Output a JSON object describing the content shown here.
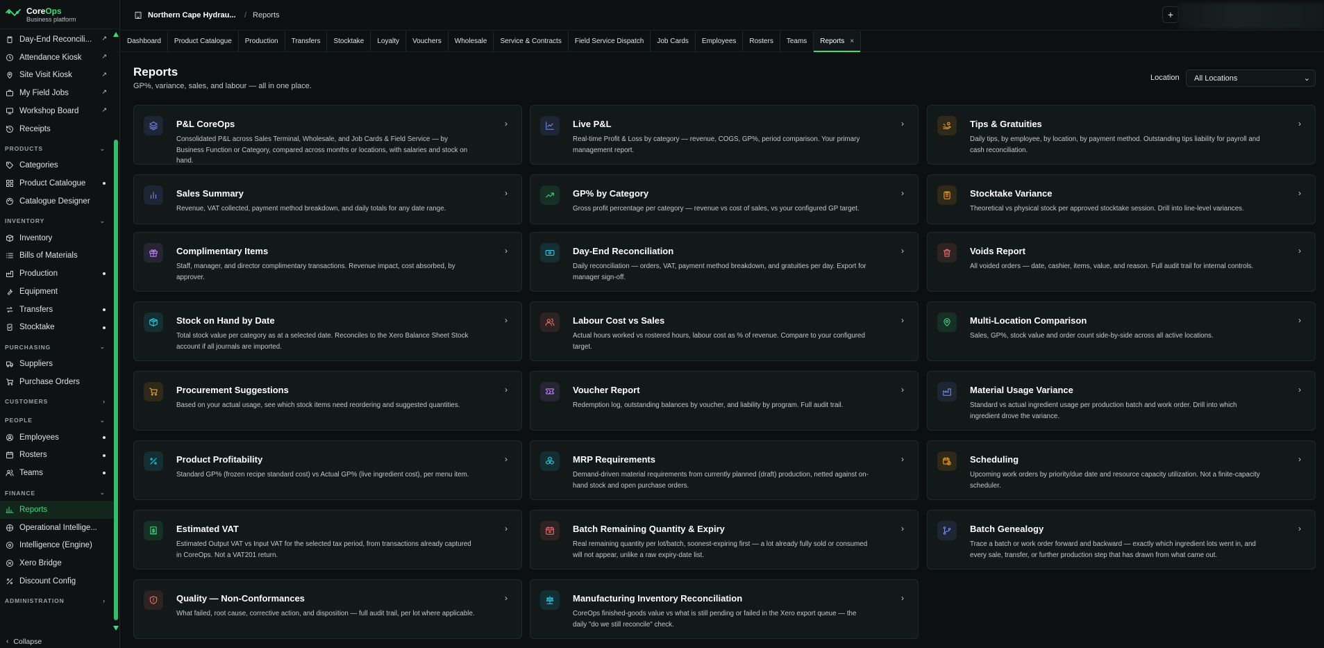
{
  "brand": {
    "name_prefix": "Core",
    "name_suffix": "Ops",
    "tagline": "Business platform"
  },
  "header": {
    "org": "Northern Cape Hydrau...",
    "separator": "/",
    "breadcrumb": "Reports",
    "plus_label": "+"
  },
  "sidebar": {
    "items": [
      {
        "type": "item",
        "label": "Day-End Reconcili...",
        "icon": "clipboard-icon",
        "ext": true
      },
      {
        "type": "item",
        "label": "Attendance Kiosk",
        "icon": "clock-icon",
        "ext": true
      },
      {
        "type": "item",
        "label": "Site Visit Kiosk",
        "icon": "pin-icon",
        "ext": true
      },
      {
        "type": "item",
        "label": "My Field Jobs",
        "icon": "briefcase-icon",
        "ext": true
      },
      {
        "type": "item",
        "label": "Workshop Board",
        "icon": "monitor-icon",
        "ext": true
      },
      {
        "type": "item",
        "label": "Receipts",
        "icon": "history-icon"
      },
      {
        "type": "section",
        "label": "PRODUCTS",
        "chev": "⌄"
      },
      {
        "type": "item",
        "label": "Categories",
        "icon": "tag-icon"
      },
      {
        "type": "item",
        "label": "Product Catalogue",
        "icon": "grid-icon",
        "dot": true
      },
      {
        "type": "item",
        "label": "Catalogue Designer",
        "icon": "palette-icon"
      },
      {
        "type": "section",
        "label": "INVENTORY",
        "chev": "⌄"
      },
      {
        "type": "item",
        "label": "Inventory",
        "icon": "box-icon"
      },
      {
        "type": "item",
        "label": "Bills of Materials",
        "icon": "list-icon"
      },
      {
        "type": "item",
        "label": "Production",
        "icon": "factory-icon",
        "dot": true
      },
      {
        "type": "item",
        "label": "Equipment",
        "icon": "wrench-icon"
      },
      {
        "type": "item",
        "label": "Transfers",
        "icon": "transfer-icon",
        "dot": true
      },
      {
        "type": "item",
        "label": "Stocktake",
        "icon": "clipboard-check-icon",
        "dot": true
      },
      {
        "type": "section",
        "label": "PURCHASING",
        "chev": "⌄"
      },
      {
        "type": "item",
        "label": "Suppliers",
        "icon": "truck-icon"
      },
      {
        "type": "item",
        "label": "Purchase Orders",
        "icon": "cart-icon"
      },
      {
        "type": "section",
        "label": "CUSTOMERS",
        "chev": "›"
      },
      {
        "type": "section",
        "label": "PEOPLE",
        "chev": "⌄"
      },
      {
        "type": "item",
        "label": "Employees",
        "icon": "user-circle-icon",
        "dot": true
      },
      {
        "type": "item",
        "label": "Rosters",
        "icon": "calendar-icon",
        "dot": true
      },
      {
        "type": "item",
        "label": "Teams",
        "icon": "users-icon",
        "dot": true
      },
      {
        "type": "section",
        "label": "FINANCE",
        "chev": "⌄"
      },
      {
        "type": "item",
        "label": "Reports",
        "icon": "chart-icon",
        "active": true
      },
      {
        "type": "item",
        "label": "Operational Intellige...",
        "icon": "brain-icon"
      },
      {
        "type": "item",
        "label": "Intelligence (Engine)",
        "icon": "cpu-icon"
      },
      {
        "type": "item",
        "label": "Xero Bridge",
        "icon": "bridge-icon"
      },
      {
        "type": "item",
        "label": "Discount Config",
        "icon": "percent-icon"
      },
      {
        "type": "section",
        "label": "ADMINISTRATION",
        "chev": "›"
      }
    ],
    "collapse_label": "Collapse"
  },
  "tabs": [
    {
      "label": "Dashboard"
    },
    {
      "label": "Product Catalogue"
    },
    {
      "label": "Production"
    },
    {
      "label": "Transfers"
    },
    {
      "label": "Stocktake"
    },
    {
      "label": "Loyalty"
    },
    {
      "label": "Vouchers"
    },
    {
      "label": "Wholesale"
    },
    {
      "label": "Service & Contracts"
    },
    {
      "label": "Field Service Dispatch"
    },
    {
      "label": "Job Cards"
    },
    {
      "label": "Employees"
    },
    {
      "label": "Rosters"
    },
    {
      "label": "Teams"
    },
    {
      "label": "Reports",
      "active": true,
      "close": "×"
    }
  ],
  "page": {
    "title": "Reports",
    "subtitle": "GP%, variance, sales, and labour — all in one place."
  },
  "location": {
    "label": "Location",
    "value": "All Locations"
  },
  "cards": [
    {
      "title": "P&L CoreOps",
      "desc": "Consolidated P&L across Sales Terminal, Wholesale, and Job Cards & Field Service — by Business Function or Category, compared across months or locations, with salaries and stock on hand.",
      "icon": "layers-icon",
      "color": "#7c8cf8"
    },
    {
      "title": "Live P&L",
      "desc": "Real-time Profit & Loss by category — revenue, COGS, GP%, period comparison. Your primary management report.",
      "icon": "line-chart-icon",
      "color": "#7c8cf8"
    },
    {
      "title": "Tips & Gratuities",
      "desc": "Daily tips, by employee, by location, by payment method. Outstanding tips liability for payroll and cash reconciliation.",
      "icon": "hand-coins-icon",
      "color": "#f5a524"
    },
    {
      "title": "Sales Summary",
      "desc": "Revenue, VAT collected, payment method breakdown, and daily totals for any date range.",
      "icon": "bar-chart-icon",
      "color": "#7c8cf8"
    },
    {
      "title": "GP% by Category",
      "desc": "Gross profit percentage per category — revenue vs cost of sales, vs your configured GP target.",
      "icon": "trending-up-icon",
      "color": "#3ddc84"
    },
    {
      "title": "Stocktake Variance",
      "desc": "Theoretical vs physical stock per approved stocktake session. Drill into line-level variances.",
      "icon": "clipboard-list-icon",
      "color": "#f5a524"
    },
    {
      "title": "Complimentary Items",
      "desc": "Staff, manager, and director complimentary transactions. Revenue impact, cost absorbed, by approver.",
      "icon": "gift-icon",
      "color": "#c084fc"
    },
    {
      "title": "Day-End Reconciliation",
      "desc": "Daily reconciliation — orders, VAT, payment method breakdown, and gratuities per day. Export for manager sign-off.",
      "icon": "banknote-icon",
      "color": "#22d3ee"
    },
    {
      "title": "Voids Report",
      "desc": "All voided orders — date, cashier, items, value, and reason. Full audit trail for internal controls.",
      "icon": "trash-icon",
      "color": "#f87171"
    },
    {
      "title": "Stock on Hand by Date",
      "desc": "Total stock value per category as at a selected date. Reconciles to the Xero Balance Sheet Stock account if all journals are imported.",
      "icon": "package-icon",
      "color": "#22d3ee"
    },
    {
      "title": "Labour Cost vs Sales",
      "desc": "Actual hours worked vs rostered hours, labour cost as % of revenue. Compare to your configured target.",
      "icon": "users-icon",
      "color": "#f87171"
    },
    {
      "title": "Multi-Location Comparison",
      "desc": "Sales, GP%, stock value and order count side-by-side across all active locations.",
      "icon": "map-pin-icon",
      "color": "#3ddc84"
    },
    {
      "title": "Procurement Suggestions",
      "desc": "Based on your actual usage, see which stock items need reordering and suggested quantities.",
      "icon": "cart-icon",
      "color": "#f5a524"
    },
    {
      "title": "Voucher Report",
      "desc": "Redemption log, outstanding balances by voucher, and liability by program. Full audit trail.",
      "icon": "ticket-icon",
      "color": "#c084fc"
    },
    {
      "title": "Material Usage Variance",
      "desc": "Standard vs actual ingredient usage per production batch and work order. Drill into which ingredient drove the variance.",
      "icon": "factory-icon",
      "color": "#7c8cf8"
    },
    {
      "title": "Product Profitability",
      "desc": "Standard GP% (frozen recipe standard cost) vs Actual GP% (live ingredient cost), per menu item.",
      "icon": "percent-icon",
      "color": "#22d3ee"
    },
    {
      "title": "MRP Requirements",
      "desc": "Demand-driven material requirements from currently planned (draft) production, netted against on-hand stock and open purchase orders.",
      "icon": "boxes-icon",
      "color": "#22d3ee"
    },
    {
      "title": "Scheduling",
      "desc": "Upcoming work orders by priority/due date and resource capacity utilization. Not a finite-capacity scheduler.",
      "icon": "calendar-clock-icon",
      "color": "#f5a524"
    },
    {
      "title": "Estimated VAT",
      "desc": "Estimated Output VAT vs Input VAT for the selected tax period, from transactions already captured in CoreOps. Not a VAT201 return.",
      "icon": "receipt-icon",
      "color": "#3ddc84"
    },
    {
      "title": "Batch Remaining Quantity & Expiry",
      "desc": "Real remaining quantity per lot/batch, soonest-expiring first — a lot already fully sold or consumed will not appear, unlike a raw expiry-date list.",
      "icon": "calendar-x-icon",
      "color": "#f87171"
    },
    {
      "title": "Batch Genealogy",
      "desc": "Trace a batch or work order forward and backward — exactly which ingredient lots went in, and every sale, transfer, or further production step that has drawn from what came out.",
      "icon": "git-branch-icon",
      "color": "#7c8cf8"
    },
    {
      "title": "Quality — Non-Conformances",
      "desc": "What failed, root cause, corrective action, and disposition — full audit trail, per lot where applicable.",
      "icon": "shield-alert-icon",
      "color": "#f87171"
    },
    {
      "title": "Manufacturing Inventory Reconciliation",
      "desc": "CoreOps finished-goods value vs what is still pending or failed in the Xero export queue — the daily \"do we still reconcile\" check.",
      "icon": "scale-icon",
      "color": "#22d3ee"
    }
  ],
  "colors": {
    "accent": "#3ddc84",
    "background": "#0d1011",
    "card": "#131819",
    "border": "#23292b"
  }
}
